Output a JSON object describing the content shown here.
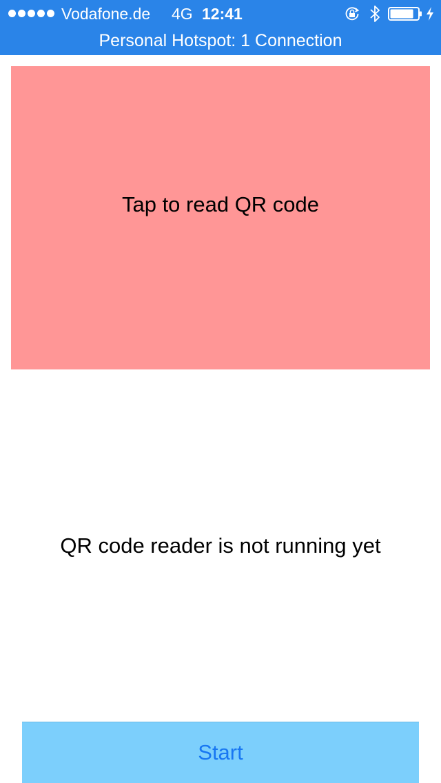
{
  "status_bar": {
    "carrier": "Vodafone.de",
    "network": "4G",
    "time": "12:41",
    "signal_bars": 5,
    "icons": [
      "signal-dots-icon",
      "orientation-lock-icon",
      "bluetooth-icon",
      "battery-icon",
      "charging-bolt-icon"
    ],
    "battery_level": 0.85,
    "background_color": "#2a84e8"
  },
  "hotspot_banner": {
    "text": "Personal Hotspot: 1 Connection"
  },
  "qr_area": {
    "label": "Tap to read QR code",
    "background_color": "#ff9696"
  },
  "status_message": "QR code reader is not running yet",
  "start_button": {
    "label": "Start",
    "background_color": "#7ccffc",
    "text_color": "#1877f2"
  }
}
